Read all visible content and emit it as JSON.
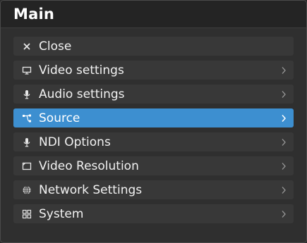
{
  "header": {
    "title": "Main"
  },
  "menu": {
    "items": [
      {
        "label": "Close",
        "icon": "close-icon",
        "has_submenu": false,
        "active": false
      },
      {
        "label": "Video settings",
        "icon": "monitor-icon",
        "has_submenu": true,
        "active": false
      },
      {
        "label": "Audio settings",
        "icon": "microphone-icon",
        "has_submenu": true,
        "active": false
      },
      {
        "label": "Source",
        "icon": "source-routing-icon",
        "has_submenu": true,
        "active": true
      },
      {
        "label": "NDI Options",
        "icon": "microphone-icon",
        "has_submenu": true,
        "active": false
      },
      {
        "label": "Video Resolution",
        "icon": "resolution-frame-icon",
        "has_submenu": true,
        "active": false
      },
      {
        "label": "Network Settings",
        "icon": "globe-icon",
        "has_submenu": true,
        "active": false
      },
      {
        "label": "System",
        "icon": "grid-icon",
        "has_submenu": true,
        "active": false
      }
    ]
  },
  "colors": {
    "active_background": "#3d8fd0",
    "item_background": "#383838",
    "window_background": "#2f2f2f",
    "header_background": "#242424",
    "text": "#f2f2f2"
  }
}
